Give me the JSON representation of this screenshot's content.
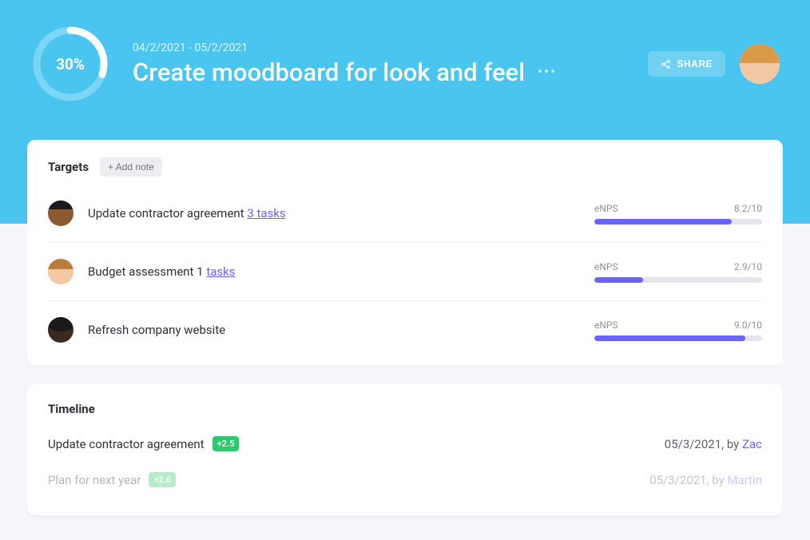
{
  "header": {
    "progress_percent": 30,
    "progress_label": "30%",
    "date_range": "04/2/2021 - 05/2/2021",
    "title": "Create moodboard for look and feel",
    "share_label": "SHARE"
  },
  "targets": {
    "section_label": "Targets",
    "add_note_label": "+ Add note",
    "items": [
      {
        "title": "Update contractor agreement",
        "tasks_label": "3 tasks",
        "metric_label": "eNPS",
        "metric_value": "8.2/10",
        "metric_fill_pct": 82
      },
      {
        "title": "Budget assessment 1",
        "tasks_label": "tasks",
        "metric_label": "eNPS",
        "metric_value": "2.9/10",
        "metric_fill_pct": 29
      },
      {
        "title": "Refresh company website",
        "tasks_label": "",
        "metric_label": "eNPS",
        "metric_value": "9.0/10",
        "metric_fill_pct": 90
      }
    ]
  },
  "timeline": {
    "section_label": "Timeline",
    "items": [
      {
        "title": "Update contractor agreement",
        "badge": "+2.5",
        "date": "05/3/2021",
        "by_label": ", by ",
        "user": "Zac",
        "faded": false
      },
      {
        "title": "Plan for next year",
        "badge": "+2.6",
        "date": "05/3/2021",
        "by_label": ", by ",
        "user": "Martin",
        "faded": true
      }
    ]
  },
  "colors": {
    "accent_blue": "#49c5f0",
    "accent_purple": "#6b63ff",
    "badge_green": "#2ec96b"
  }
}
